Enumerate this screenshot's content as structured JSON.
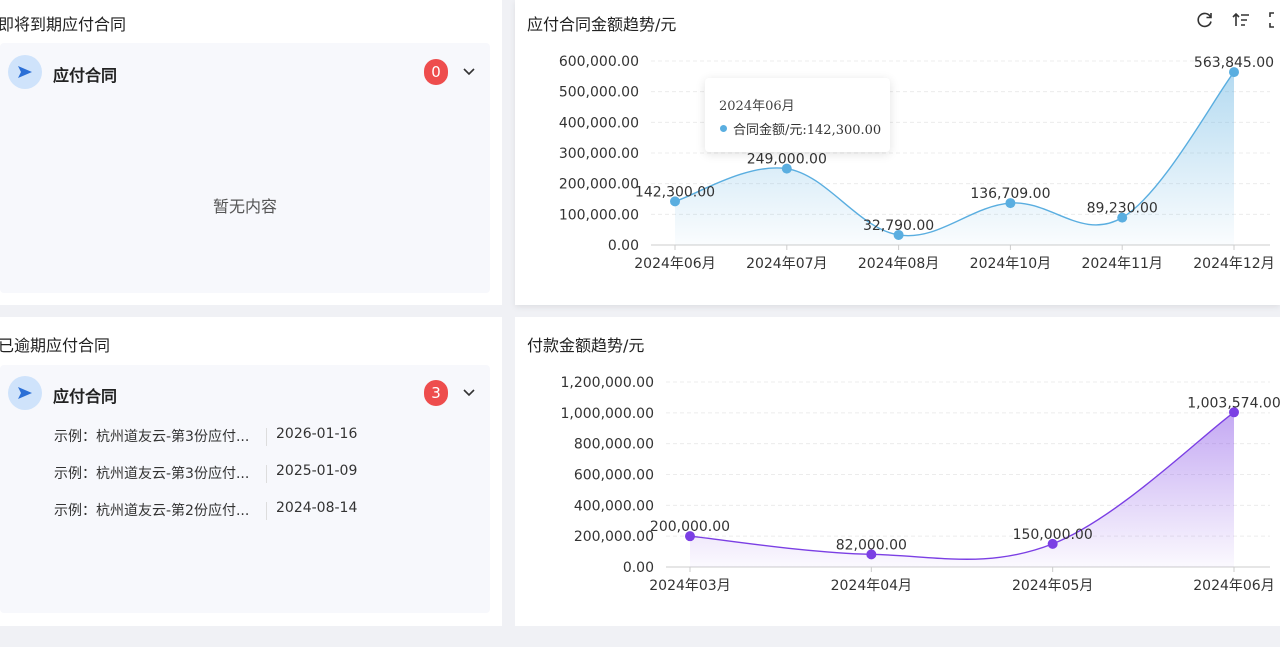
{
  "upcoming": {
    "title": "即将到期应付合同",
    "group_label": "应付合同",
    "count": "0",
    "empty_text": "暂无内容"
  },
  "overdue": {
    "title": "已逾期应付合同",
    "group_label": "应付合同",
    "count": "3",
    "items": [
      {
        "name": "示例：杭州道友云-第3份应付...",
        "date": "2026-01-16"
      },
      {
        "name": "示例：杭州道友云-第3份应付...",
        "date": "2025-01-09"
      },
      {
        "name": "示例：杭州道友云-第2份应付...",
        "date": "2024-08-14"
      }
    ]
  },
  "toolbar": {
    "icons": [
      "refresh-icon",
      "sort-icon",
      "fullscreen-icon"
    ]
  },
  "tooltip": {
    "period": "2024年06月",
    "series_text": "合同金额/元:142,300.00"
  },
  "chart_data": [
    {
      "type": "area",
      "title": "应付合同金额趋势/元",
      "categories": [
        "2024年06月",
        "2024年07月",
        "2024年08月",
        "2024年10月",
        "2024年11月",
        "2024年12月"
      ],
      "values": [
        142300,
        249000,
        32790,
        136709,
        89230,
        563845
      ],
      "value_labels": [
        "142,300.00",
        "249,000.00",
        "32,790.00",
        "136,709.00",
        "89,230.00",
        "563,845.00"
      ],
      "yticks": [
        "0.00",
        "100,000.00",
        "200,000.00",
        "300,000.00",
        "400,000.00",
        "500,000.00",
        "600,000.00"
      ],
      "ylim": [
        0,
        600000
      ],
      "color": "#5aaee0",
      "grid": true
    },
    {
      "type": "area",
      "title": "付款金额趋势/元",
      "categories": [
        "2024年03月",
        "2024年04月",
        "2024年05月",
        "2024年06月"
      ],
      "values": [
        200000,
        82000,
        150000,
        1003574
      ],
      "value_labels": [
        "200,000.00",
        "82,000.00",
        "150,000.00",
        "1,003,574.00"
      ],
      "yticks": [
        "0.00",
        "200,000.00",
        "400,000.00",
        "600,000.00",
        "800,000.00",
        "1,000,000.00",
        "1,200,000.00"
      ],
      "ylim": [
        0,
        1200000
      ],
      "color": "#7b3fe4",
      "grid": true
    }
  ]
}
